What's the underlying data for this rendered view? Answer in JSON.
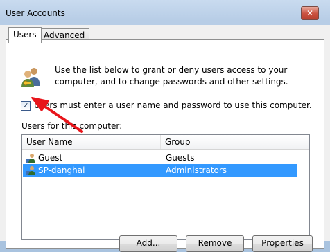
{
  "window": {
    "title": "User Accounts"
  },
  "tabs": [
    {
      "label": "Users",
      "active": true
    },
    {
      "label": "Advanced",
      "active": false
    }
  ],
  "intro_text": "Use the list below to grant or deny users access to your computer, and to change passwords and other settings.",
  "checkbox": {
    "label": "Users must enter a user name and password to use this computer.",
    "checked": true
  },
  "list": {
    "caption": "Users for this computer:",
    "columns": [
      "User Name",
      "Group"
    ],
    "rows": [
      {
        "name": "Guest",
        "group": "Guests",
        "selected": false
      },
      {
        "name": "SP-danghai",
        "group": "Administrators",
        "selected": true
      }
    ]
  },
  "buttons": {
    "add": "Add...",
    "remove": "Remove",
    "properties": "Properties"
  },
  "colors": {
    "selection": "#3399ff",
    "annotation_arrow": "#e8151b"
  },
  "icons": {
    "users": "users-icon",
    "user": "user-icon",
    "close": "close-icon"
  }
}
